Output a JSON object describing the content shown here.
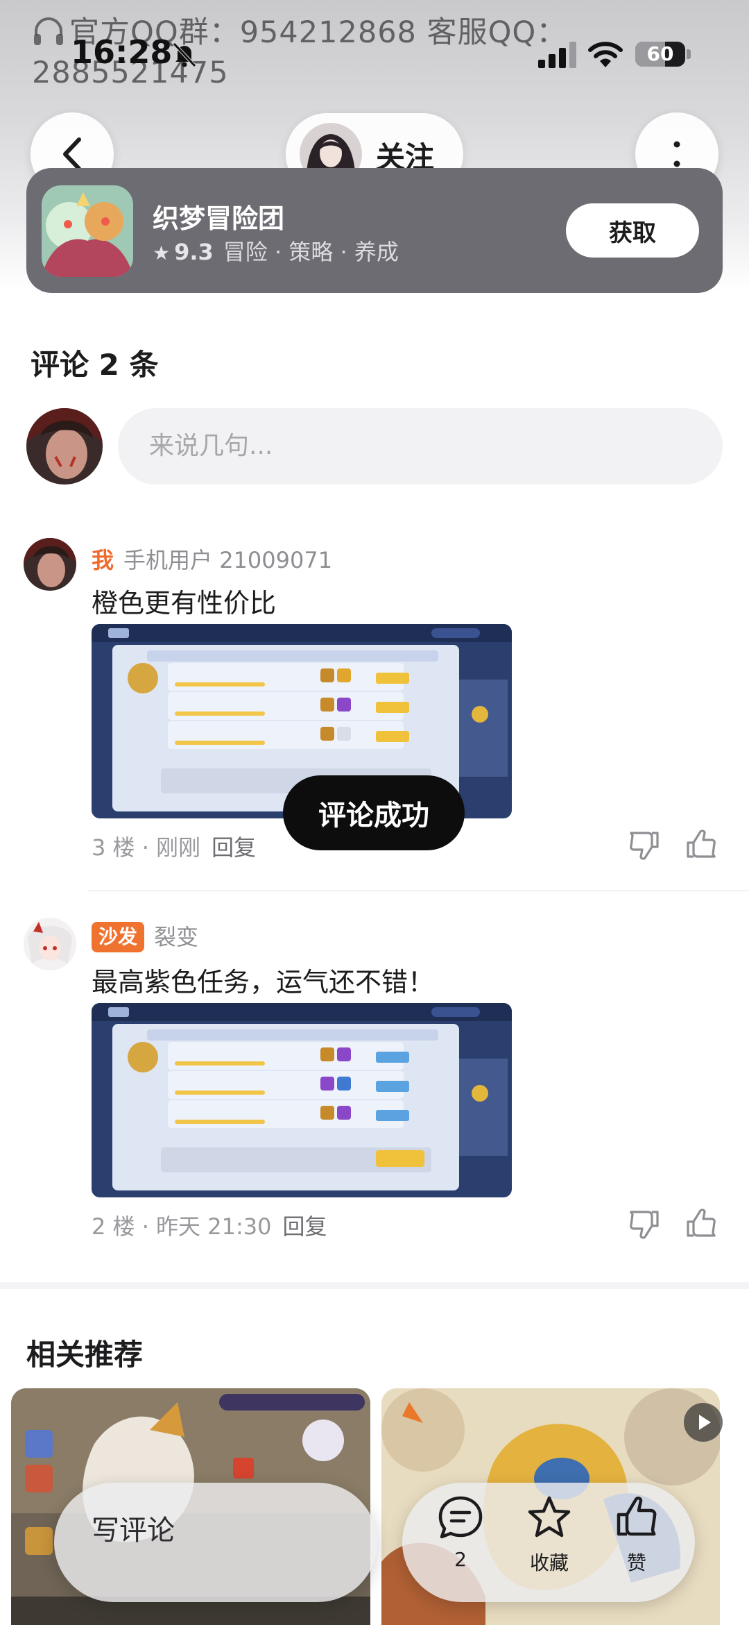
{
  "status_bar": {
    "time": "16:28",
    "battery": "60",
    "battery_level": 0.6
  },
  "banner": {
    "text": "官方QQ群：954212868    客服QQ：2885521475"
  },
  "header": {
    "follow_label": "关注"
  },
  "game": {
    "name": "织梦冒险团",
    "rating": "9.3",
    "tags": "冒险 · 策略 · 养成",
    "get_label": "获取"
  },
  "comments_section": {
    "title": "评论 2 条",
    "input_placeholder": "来说几句..."
  },
  "comments": [
    {
      "badge": "我",
      "user": "手机用户 21009071",
      "text": "橙色更有性价比",
      "floor_time": "3 楼 · 刚刚",
      "reply_label": "回复"
    },
    {
      "badge": "沙发",
      "user": "裂变",
      "text": "最高紫色任务，运气还不错！",
      "floor_time": "2 楼 · 昨天 21:30",
      "reply_label": "回复"
    }
  ],
  "toast": {
    "text": "评论成功"
  },
  "recommend": {
    "title": "相关推荐"
  },
  "bottom_bar": {
    "write_label": "写评论",
    "comment_count": "2",
    "favorite_label": "收藏",
    "like_label": "赞"
  },
  "colors": {
    "accent_orange": "#f0722f",
    "card_bg": "#6e6c73",
    "toast_bg": "#0d0d0d"
  },
  "icons": [
    "back-icon",
    "more-icon",
    "headset-icon",
    "bell-off-icon",
    "signal-icon",
    "wifi-icon",
    "star-icon",
    "dislike-icon",
    "like-icon",
    "comment-icon",
    "favorite-icon",
    "play-icon"
  ]
}
